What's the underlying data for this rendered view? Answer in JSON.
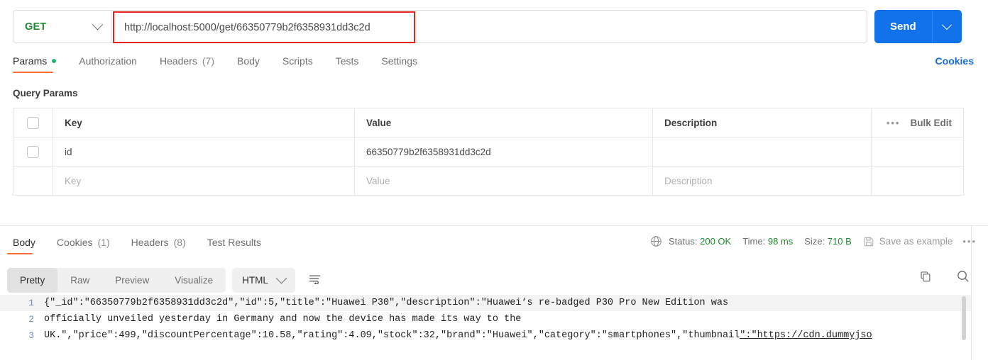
{
  "request": {
    "method": "GET",
    "url": "http://localhost:5000/get/66350779b2f6358931dd3c2d",
    "send_label": "Send",
    "url_highlight_color": "#e8231c",
    "method_color": "#1d8a2f",
    "send_color": "#1272ec"
  },
  "request_tabs": [
    {
      "label": "Params",
      "count": "",
      "active": true,
      "dot": true
    },
    {
      "label": "Authorization",
      "count": "",
      "active": false,
      "dot": false
    },
    {
      "label": "Headers",
      "count": "(7)",
      "active": false,
      "dot": false
    },
    {
      "label": "Body",
      "count": "",
      "active": false,
      "dot": false
    },
    {
      "label": "Scripts",
      "count": "",
      "active": false,
      "dot": false
    },
    {
      "label": "Tests",
      "count": "",
      "active": false,
      "dot": false
    },
    {
      "label": "Settings",
      "count": "",
      "active": false,
      "dot": false
    }
  ],
  "cookies_link": "Cookies",
  "query_params": {
    "section_title": "Query Params",
    "headers": [
      "Key",
      "Value",
      "Description"
    ],
    "bulk_edit_label": "Bulk Edit",
    "rows": [
      {
        "key": "id",
        "value": "66350779b2f6358931dd3c2d",
        "description": "",
        "checked": false,
        "placeholder_row": false
      },
      {
        "key": "Key",
        "value": "Value",
        "description": "Description",
        "checked": false,
        "placeholder_row": true
      }
    ]
  },
  "response_tabs": [
    {
      "label": "Body",
      "count": "",
      "active": true
    },
    {
      "label": "Cookies",
      "count": "(1)",
      "active": false
    },
    {
      "label": "Headers",
      "count": "(8)",
      "active": false
    },
    {
      "label": "Test Results",
      "count": "",
      "active": false
    }
  ],
  "response_meta": {
    "status_label": "Status:",
    "status_value": "200 OK",
    "time_label": "Time:",
    "time_value": "98 ms",
    "size_label": "Size:",
    "size_value": "710 B",
    "save_as_example": "Save as example",
    "ok_color": "#1d8a2f"
  },
  "format_bar": {
    "modes": [
      {
        "label": "Pretty",
        "active": true
      },
      {
        "label": "Raw",
        "active": false
      },
      {
        "label": "Preview",
        "active": false
      },
      {
        "label": "Visualize",
        "active": false
      }
    ],
    "language": "HTML"
  },
  "response_body": {
    "lines": [
      {
        "num": "1",
        "text": "{\"_id\":\"66350779b2f6358931dd3c2d\",\"id\":5,\"title\":\"Huawei P30\",\"description\":\"Huawei‘s re-badged P30 Pro New Edition was",
        "highlight": true,
        "link_from": -1
      },
      {
        "num": "2",
        "text": "officially unveiled yesterday in Germany and now the device has made its way to the",
        "highlight": false,
        "link_from": -1
      },
      {
        "num": "3",
        "text": "UK.\",\"price\":499,\"discountPercentage\":10.58,\"rating\":4.09,\"stock\":32,\"brand\":\"Huawei\",\"category\":\"smartphones\",\"thumbnail\":\"https://cdn.dummyjso",
        "highlight": false,
        "link_from": 121
      }
    ]
  }
}
